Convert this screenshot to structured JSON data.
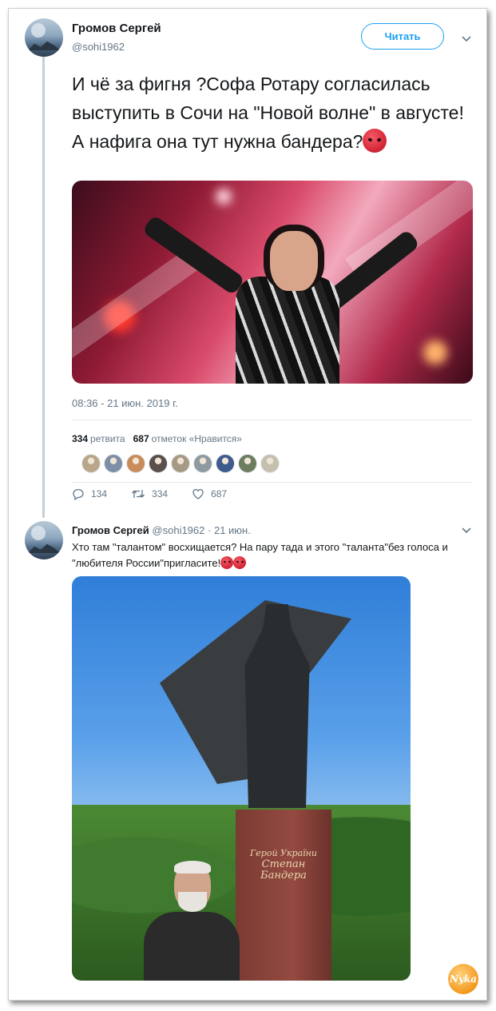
{
  "tweet": {
    "author_name": "Громов Сергей",
    "author_handle": "@sohi1962",
    "follow_label": "Читать",
    "text": "И чё за фигня ?Софа Ротару согласилась выступить в Сочи на \"Новой волне\" в августе! А нафига она тут нужна бандера?",
    "timestamp": "08:36 - 21 июн. 2019 г.",
    "retweets_count": "334",
    "retweets_label": "ретвита",
    "likes_count": "687",
    "likes_label": "отметок «Нравится»",
    "reply_count": "134",
    "retweet_action_count": "334",
    "like_action_count": "687"
  },
  "reply": {
    "author_name": "Громов Сергей",
    "author_handle": "@sohi1962",
    "separator": "·",
    "date": "21 июн.",
    "text": "Хто там \"талантом\" восхищается? На пару тада и этого \"таланта\"без голоса и \"любителя России\"пригласите!"
  },
  "statue_plaque": {
    "line1": "Герой України",
    "line2": "Степан",
    "line3": "Бандера"
  },
  "watermark": "Nyka",
  "colors": {
    "accent": "#1da1f2",
    "secondary_text": "#657786",
    "primary_text": "#14171a"
  },
  "icons": [
    "chevron-down-icon",
    "reply-icon",
    "retweet-icon",
    "heart-icon",
    "angry-face-emoji"
  ],
  "liker_avatar_colors": [
    "#b9a68a",
    "#7d8ea6",
    "#c98b5a",
    "#5a4f4a",
    "#a79a84",
    "#8e9aa0",
    "#3f5b8c",
    "#6d7d5f",
    "#c5bfae"
  ]
}
